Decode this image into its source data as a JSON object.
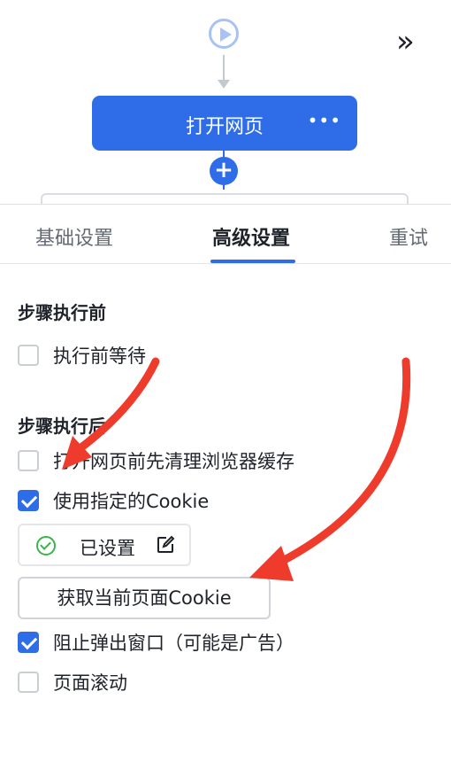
{
  "flow": {
    "start_icon": "play-circle-icon",
    "node_title": "打开网页",
    "node_more": "•••",
    "add_symbol": "+",
    "expand_symbol": "»"
  },
  "tabs": [
    {
      "label": "基础设置"
    },
    {
      "label": "高级设置",
      "active": true
    },
    {
      "label": "重试"
    }
  ],
  "before": {
    "title": "步骤执行前",
    "options": [
      {
        "label": "执行前等待",
        "checked": false
      }
    ]
  },
  "after": {
    "title": "步骤执行后",
    "options": [
      {
        "label": "打开网页前先清理浏览器缓存",
        "checked": false
      },
      {
        "label": "使用指定的Cookie",
        "checked": true
      },
      {
        "label": "阻止弹出窗口（可能是广告）",
        "checked": true
      },
      {
        "label": "页面滚动",
        "checked": false
      }
    ],
    "cookie_status": "已设置",
    "get_cookie_button": "获取当前页面Cookie"
  },
  "colors": {
    "accent": "#2f6de8",
    "success": "#3cb44b",
    "annotation_arrow": "#ee3b2b"
  }
}
